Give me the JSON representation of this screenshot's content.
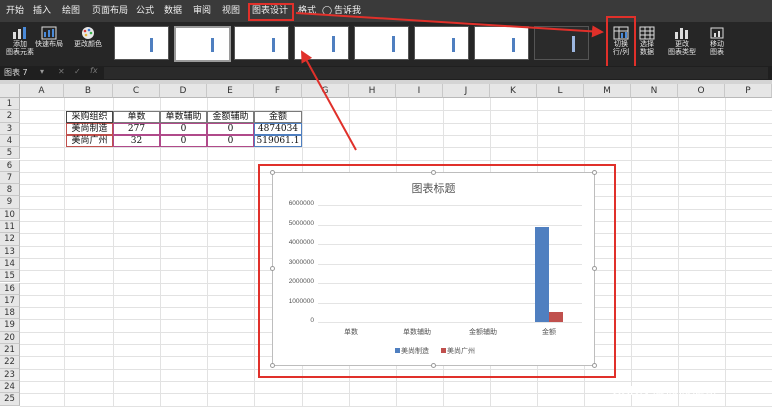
{
  "menu": {
    "items": [
      "开始",
      "插入",
      "绘图",
      "页面布局",
      "公式",
      "数据",
      "审阅",
      "视图",
      "图表设计",
      "格式"
    ],
    "tellme": "告诉我"
  },
  "ribbon": {
    "add_element": "添加\n图表元素",
    "quick_layout": "快速布局",
    "change_colors": "更改颜色",
    "switch_row_col": "切换\n行/列",
    "select_data": "选择\n数据",
    "change_type": "更改\n图表类型",
    "move_chart": "移动\n图表"
  },
  "namebox": "图表 7",
  "fx": "fx",
  "columns": [
    "A",
    "B",
    "C",
    "D",
    "E",
    "F",
    "G",
    "H",
    "I",
    "J",
    "K",
    "L",
    "M",
    "N",
    "O",
    "P"
  ],
  "rows": [
    "1",
    "2",
    "3",
    "4",
    "5",
    "6",
    "7",
    "8",
    "9",
    "10",
    "11",
    "12",
    "13",
    "14",
    "15",
    "16",
    "17",
    "18",
    "19",
    "20",
    "21",
    "22",
    "23",
    "24",
    "25"
  ],
  "table": {
    "header": [
      "采购组织",
      "单数",
      "单数辅助",
      "金额辅助",
      "金额"
    ],
    "rows": [
      [
        "美尚制造",
        "277",
        "0",
        "0",
        "4874034"
      ],
      [
        "美尚广州",
        "32",
        "0",
        "0",
        "519061.1"
      ]
    ]
  },
  "chart_data": {
    "type": "bar",
    "title": "图表标题",
    "categories": [
      "单数",
      "单数辅助",
      "金额辅助",
      "金额"
    ],
    "series": [
      {
        "name": "美尚制造",
        "values": [
          277,
          0,
          0,
          4874034
        ],
        "color": "#4f7fc0"
      },
      {
        "name": "美尚广州",
        "values": [
          32,
          0,
          0,
          519061.1
        ],
        "color": "#c0504d"
      }
    ],
    "yticks": [
      "6000000",
      "5000000",
      "4000000",
      "3000000",
      "2000000",
      "1000000",
      "0"
    ],
    "ylim": [
      0,
      6000000
    ],
    "legend_position": "bottom"
  },
  "watermark": "CSDN @晨晨渝奇"
}
